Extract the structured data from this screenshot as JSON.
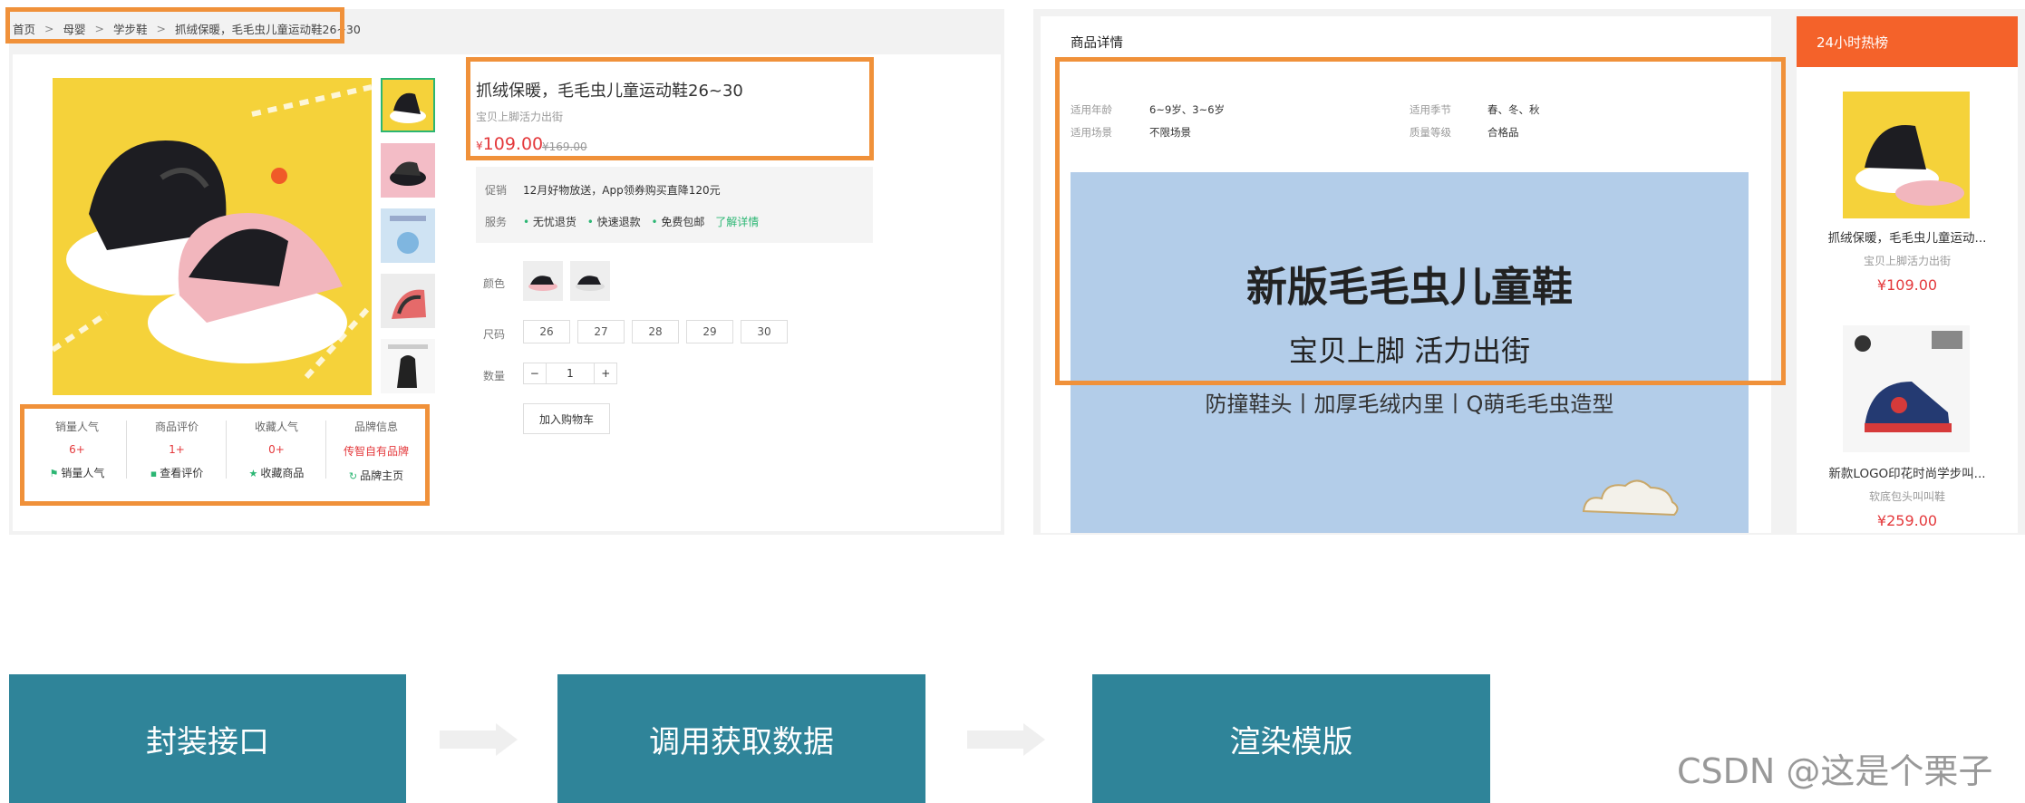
{
  "breadcrumb": [
    "首页",
    "母婴",
    "学步鞋",
    "抓绒保暖，毛毛虫儿童运动鞋26~30"
  ],
  "breadcrumb_sep": ">",
  "product": {
    "title": "抓绒保暖，毛毛虫儿童运动鞋26~30",
    "subtitle": "宝贝上脚活力出街",
    "price_symbol": "¥",
    "price": "109.00",
    "old_price": "¥169.00"
  },
  "stats": [
    {
      "title": "销量人气",
      "value": "6+",
      "link": "销量人气",
      "icon": "flag-icon"
    },
    {
      "title": "商品评价",
      "value": "1+",
      "link": "查看评价",
      "icon": "comment-icon"
    },
    {
      "title": "收藏人气",
      "value": "0+",
      "link": "收藏商品",
      "icon": "star-icon"
    },
    {
      "title": "品牌信息",
      "value": "传智自有品牌",
      "link": "品牌主页",
      "icon": "refresh-icon"
    }
  ],
  "promo": {
    "label": "促销",
    "text": "12月好物放送，App领券购买直降120元",
    "service_label": "服务",
    "services": [
      "无忧退货",
      "快速退款",
      "免费包邮"
    ],
    "detail_link": "了解详情"
  },
  "options": {
    "color_label": "颜色",
    "size_label": "尺码",
    "sizes": [
      "26",
      "27",
      "28",
      "29",
      "30"
    ],
    "qty_label": "数量",
    "qty_minus": "−",
    "qty_value": "1",
    "qty_plus": "+",
    "cart_button": "加入购物车"
  },
  "details": {
    "tab": "商品详情",
    "attrs": [
      {
        "k": "适用年龄",
        "v": "6~9岁、3~6岁"
      },
      {
        "k": "适用季节",
        "v": "春、冬、秋"
      },
      {
        "k": "适用场景",
        "v": "不限场景"
      },
      {
        "k": "质量等级",
        "v": "合格品"
      }
    ],
    "banner_h1": "新版毛毛虫儿童鞋",
    "banner_h2": "宝贝上脚 活力出街",
    "banner_h3": "防撞鞋头丨加厚毛绒内里丨Q萌毛毛虫造型"
  },
  "hot": {
    "title": "24小时热榜",
    "items": [
      {
        "name": "抓绒保暖，毛毛虫儿童运动...",
        "sub": "宝贝上脚活力出街",
        "price": "¥109.00"
      },
      {
        "name": "新款LOGO印花时尚学步叫...",
        "sub": "软底包头叫叫鞋",
        "price": "¥259.00"
      }
    ]
  },
  "flow": [
    "封装接口",
    "调用获取数据",
    "渲染模版"
  ],
  "watermark": "CSDN @这是个栗子",
  "colors": {
    "accent": "#f0913a",
    "price": "#e4393c",
    "green": "#2bb673",
    "hot": "#f4622a",
    "flow_box": "#2f8499"
  }
}
